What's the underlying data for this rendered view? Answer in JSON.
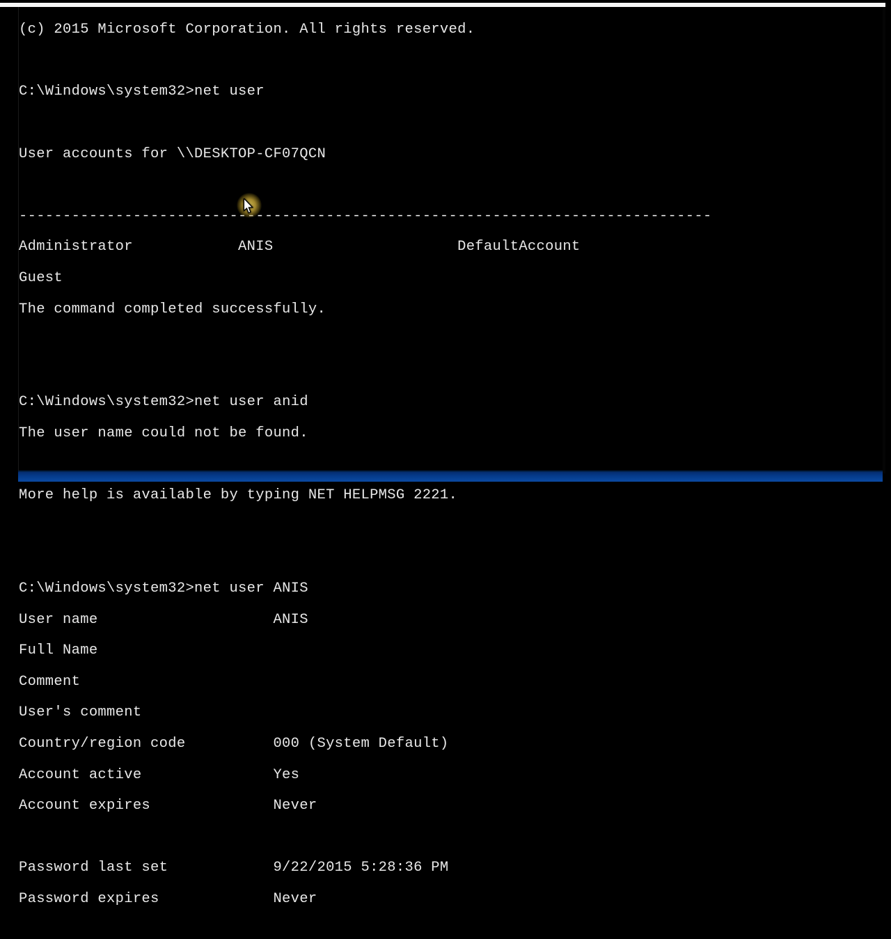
{
  "copyright": "(c) 2015 Microsoft Corporation. All rights reserved.",
  "block1": {
    "prompt": "C:\\Windows\\system32>",
    "command": "net user",
    "header": "User accounts for \\\\DESKTOP-CF07QCN",
    "divider": "-------------------------------------------------------------------------------",
    "row1": "Administrator            ANIS                     DefaultAccount",
    "row2": "Guest",
    "done": "The command completed successfully."
  },
  "block2": {
    "prompt": "C:\\Windows\\system32>",
    "command": "net user anid",
    "error": "The user name could not be found.",
    "help": "More help is available by typing NET HELPMSG 2221."
  },
  "block3": {
    "prompt": "C:\\Windows\\system32>",
    "command": "net user ANIS",
    "r1": "User name                    ANIS",
    "r2": "Full Name",
    "r3": "Comment",
    "r4": "User's comment",
    "r5": "Country/region code          000 (System Default)",
    "r6": "Account active               Yes",
    "r7": "Account expires              Never",
    "r8": "Password last set            9/22/2015 5:28:36 PM",
    "r9": "Password expires             Never"
  }
}
